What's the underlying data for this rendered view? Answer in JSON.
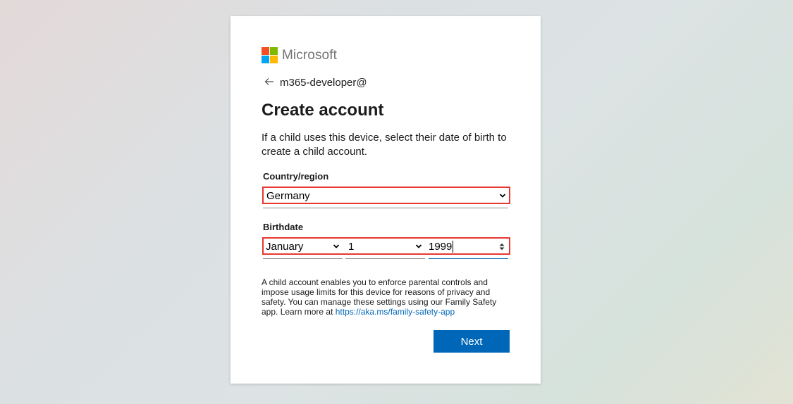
{
  "brand": {
    "name": "Microsoft",
    "logo_colors": [
      "#f25022",
      "#7fba00",
      "#00a4ef",
      "#ffb900"
    ]
  },
  "identity": {
    "back_icon": "back-arrow-icon",
    "email": "m365-developer@"
  },
  "page": {
    "title": "Create account",
    "description": "If a child uses this device, select their date of birth to create a child account."
  },
  "country": {
    "label": "Country/region",
    "selected": "Germany"
  },
  "birthdate": {
    "label": "Birthdate",
    "month": "January",
    "day": "1",
    "year": "1999"
  },
  "info": {
    "text": "A child account enables you to enforce parental controls and impose usage limits for this device for reasons of privacy and safety. You can manage these settings using our Family Safety app. Learn more at ",
    "link": "https://aka.ms/family-safety-app"
  },
  "actions": {
    "next_label": "Next"
  },
  "colors": {
    "accent": "#0067b8",
    "highlight": "#e8382f"
  }
}
